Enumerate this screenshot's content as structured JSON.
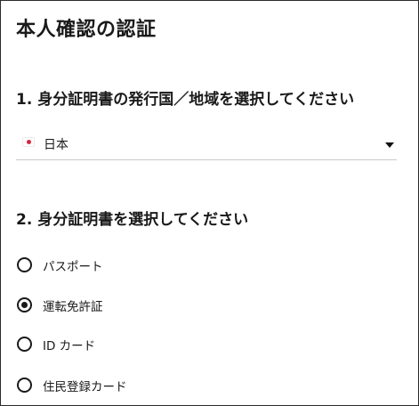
{
  "page": {
    "title": "本人確認の認証"
  },
  "country_section": {
    "heading": "1. 身分証明書の発行国／地域を選択してください",
    "selected_country": "日本",
    "flag_icon": "japan-flag-icon"
  },
  "document_section": {
    "heading": "2. 身分証明書を選択してください",
    "options": [
      {
        "label": "パスポート",
        "checked": false
      },
      {
        "label": "運転免許証",
        "checked": true
      },
      {
        "label": "ID カード",
        "checked": false
      },
      {
        "label": "住民登録カード",
        "checked": false
      }
    ]
  }
}
